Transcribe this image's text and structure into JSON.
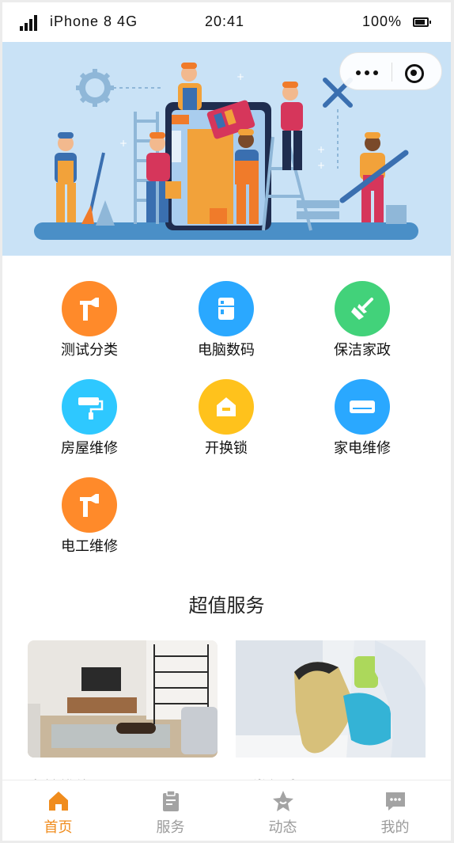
{
  "status_bar": {
    "carrier": "iPhone 8  4G",
    "time": "20:41",
    "battery": "100%"
  },
  "banner": {
    "alt": "repair workers illustration"
  },
  "categories": [
    {
      "label": "测试分类",
      "icon": "hammer-icon",
      "color": "#ff8a2a"
    },
    {
      "label": "电脑数码",
      "icon": "fridge-icon",
      "color": "#2aa8ff"
    },
    {
      "label": "保洁家政",
      "icon": "broom-icon",
      "color": "#42d27a"
    },
    {
      "label": "房屋维修",
      "icon": "paint-roller-icon",
      "color": "#2ec8ff"
    },
    {
      "label": "开换锁",
      "icon": "house-lock-icon",
      "color": "#ffc21c"
    },
    {
      "label": "家电维修",
      "icon": "air-conditioner-icon",
      "color": "#2aa8ff"
    },
    {
      "label": "电工维修",
      "icon": "hammer-icon",
      "color": "#ff8a2a"
    }
  ],
  "section": {
    "title": "超值服务"
  },
  "cards": [
    {
      "title": "家纺维修"
    },
    {
      "title": "日常保洁"
    }
  ],
  "tabbar": {
    "items": [
      {
        "label": "首页",
        "icon": "home-icon",
        "active": true
      },
      {
        "label": "服务",
        "icon": "clipboard-icon",
        "active": false
      },
      {
        "label": "动态",
        "icon": "star-icon",
        "active": false
      },
      {
        "label": "我的",
        "icon": "chat-icon",
        "active": false
      }
    ],
    "active_color": "#f08c1d",
    "inactive_color": "#9b9b9b"
  }
}
